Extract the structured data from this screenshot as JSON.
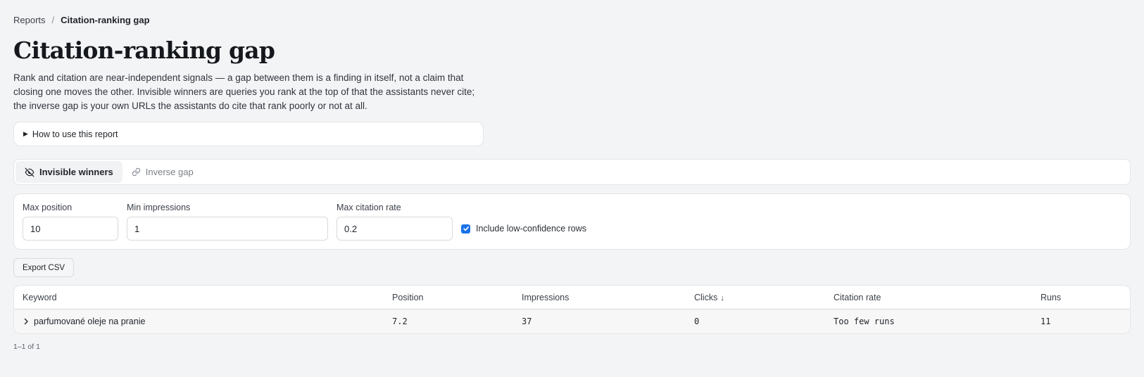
{
  "breadcrumb": {
    "parent": "Reports",
    "separator": "/",
    "current": "Citation-ranking gap"
  },
  "page": {
    "title": "Citation-ranking gap",
    "description": "Rank and citation are near-independent signals — a gap between them is a finding in itself, not a claim that closing one moves the other. Invisible winners are queries you rank at the top of that the assistants never cite; the inverse gap is your own URLs the assistants do cite that rank poorly or not at all."
  },
  "howto": {
    "label": "How to use this report"
  },
  "tabs": [
    {
      "label": "Invisible winners",
      "icon": "eye-off-icon",
      "active": true
    },
    {
      "label": "Inverse gap",
      "icon": "link-icon",
      "active": false
    }
  ],
  "filters": {
    "max_position": {
      "label": "Max position",
      "value": "10"
    },
    "min_impressions": {
      "label": "Min impressions",
      "value": "1"
    },
    "max_citation_rate": {
      "label": "Max citation rate",
      "value": "0.2"
    },
    "low_confidence": {
      "label": "Include low-confidence rows",
      "checked": true
    }
  },
  "export": {
    "label": "Export CSV"
  },
  "table": {
    "columns": [
      "Keyword",
      "Position",
      "Impressions",
      "Clicks",
      "Citation rate",
      "Runs"
    ],
    "sort_indicator": "↓",
    "rows": [
      {
        "keyword": "parfumované oleje na pranie",
        "position": "7.2",
        "impressions": "37",
        "clicks": "0",
        "citation_rate": "Too few runs",
        "runs": "11"
      }
    ]
  },
  "pagination": {
    "text": "1–1 of 1"
  },
  "colors": {
    "accent": "#1a73e8",
    "background": "#f3f4f6"
  }
}
